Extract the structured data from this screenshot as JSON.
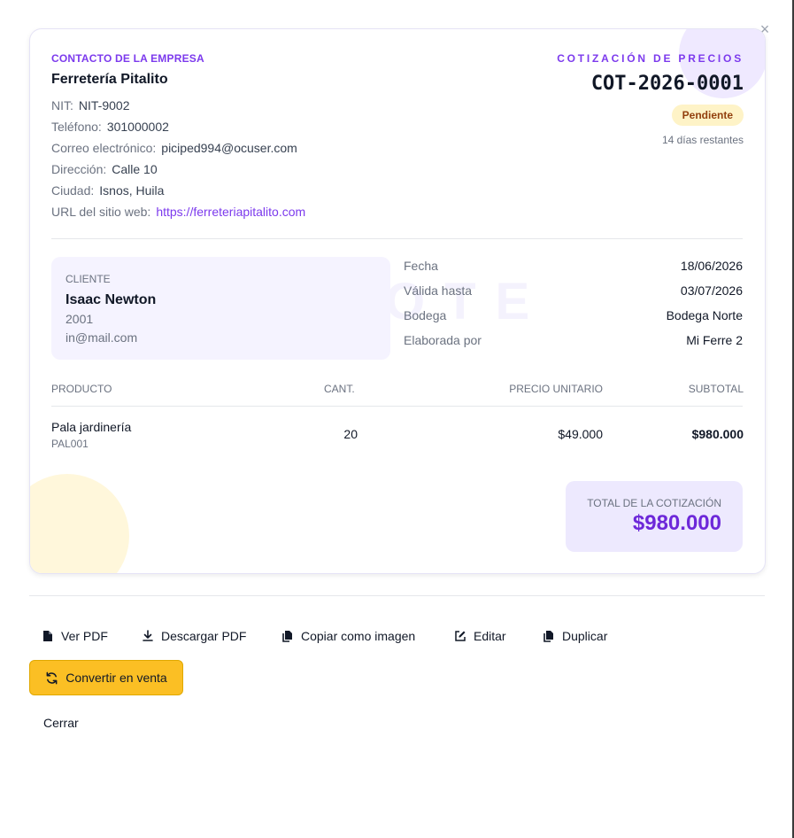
{
  "dialog": {
    "close_symbol": "×"
  },
  "company": {
    "label": "CONTACTO DE LA EMPRESA",
    "name": "Ferretería Pitalito",
    "nit_label": "NIT:",
    "nit": "NIT-9002",
    "phone_label": "Teléfono:",
    "phone": "301000002",
    "email_label": "Correo electrónico:",
    "email": "piciped994@ocuser.com",
    "address_label": "Dirección:",
    "address": "Calle 10",
    "city_label": "Ciudad:",
    "city": "Isnos, Huila",
    "website_label": "URL del sitio web:",
    "website": "https://ferreteriapitalito.com"
  },
  "quote": {
    "label": "COTIZACIÓN DE PRECIOS",
    "number": "COT-2026-0001",
    "status": "Pendiente",
    "days_left": "14 días restantes",
    "watermark": "QUOTE"
  },
  "client": {
    "label": "CLIENTE",
    "name": "Isaac Newton",
    "id": "2001",
    "email": "in@mail.com"
  },
  "meta": {
    "date_label": "Fecha",
    "date": "18/06/2026",
    "valid_label": "Válida hasta",
    "valid": "03/07/2026",
    "warehouse_label": "Bodega",
    "warehouse": "Bodega Norte",
    "author_label": "Elaborada por",
    "author": "Mi Ferre 2"
  },
  "table": {
    "headers": {
      "product": "PRODUCTO",
      "qty": "CANT.",
      "unit_price": "PRECIO UNITARIO",
      "subtotal": "SUBTOTAL"
    },
    "rows": [
      {
        "name": "Pala jardinería",
        "code": "PAL001",
        "qty": "20",
        "unit_price": "$49.000",
        "subtotal": "$980.000"
      }
    ]
  },
  "total": {
    "label": "TOTAL DE LA COTIZACIÓN",
    "value": "$980.000"
  },
  "actions": {
    "view_pdf": "Ver PDF",
    "download_pdf": "Descargar PDF",
    "copy_image": "Copiar como imagen",
    "edit": "Editar",
    "duplicate": "Duplicar",
    "convert": "Convertir en venta",
    "close": "Cerrar"
  },
  "colors": {
    "accent": "#7c3aed",
    "convert_button": "#fbbf24",
    "status_badge": "#fef3c7"
  },
  "icons": [
    "close-icon",
    "file-icon",
    "download-icon",
    "copy-icon",
    "edit-icon",
    "duplicate-icon",
    "refresh-icon"
  ]
}
